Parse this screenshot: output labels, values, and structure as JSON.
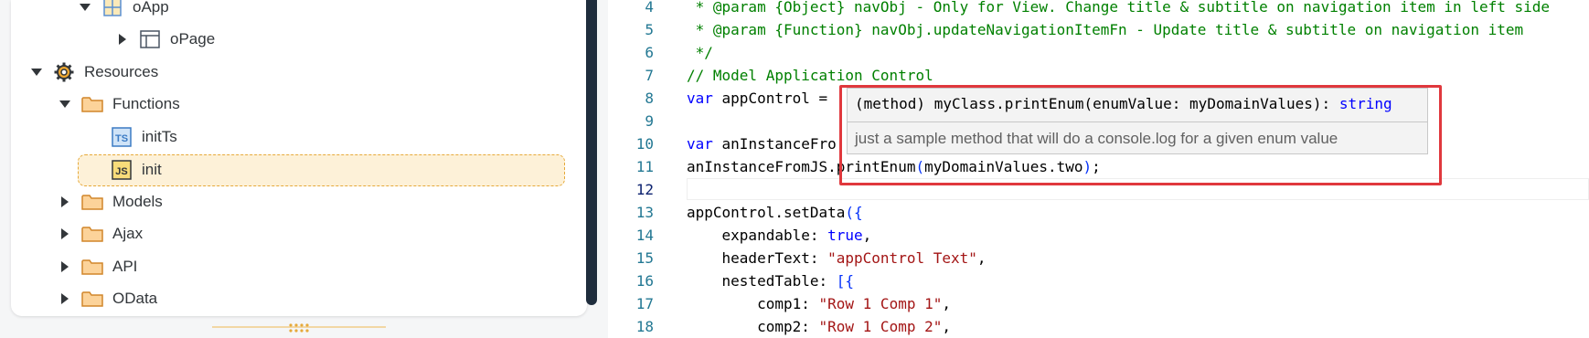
{
  "tree": {
    "items": [
      {
        "label": "oApp",
        "icon": "app-grid-icon",
        "state": "expanded"
      },
      {
        "label": "oPage",
        "icon": "page-layout-icon",
        "state": "collapsed"
      },
      {
        "label": "Resources",
        "icon": "gear-icon",
        "state": "expanded"
      },
      {
        "label": "Functions",
        "icon": "folder-icon",
        "state": "expanded"
      },
      {
        "label": "initTs",
        "icon": "typescript-file-icon",
        "badge": "TS",
        "state": "leaf"
      },
      {
        "label": "init",
        "icon": "javascript-file-icon",
        "badge": "JS",
        "state": "leaf",
        "selected": true
      },
      {
        "label": "Models",
        "icon": "folder-icon",
        "state": "collapsed"
      },
      {
        "label": "Ajax",
        "icon": "folder-icon",
        "state": "collapsed"
      },
      {
        "label": "API",
        "icon": "folder-icon",
        "state": "collapsed"
      },
      {
        "label": "OData",
        "icon": "folder-icon",
        "state": "collapsed"
      }
    ]
  },
  "editor": {
    "line_numbers": [
      "4",
      "5",
      "6",
      "7",
      "8",
      "9",
      "10",
      "11",
      "12",
      "13",
      "14",
      "15",
      "16",
      "17",
      "18"
    ],
    "code": {
      "l4": " * @param {Object} navObj - Only for View. Change title & subtitle on navigation item in left side",
      "l5": " * @param {Function} navObj.updateNavigationItemFn - Update title & subtitle on navigation item",
      "l6": " */",
      "l7": "// Model Application Control",
      "l8_kw": "var",
      "l8_rest": " appControl = ",
      "l10_kw": "var",
      "l10_rest": " anInstanceFro",
      "l11_a": "anInstanceFromJS.printEnum",
      "l11_b": "(",
      "l11_c": "myDomainValues.two",
      "l11_d": ")",
      "l11_e": ";",
      "l13_a": "appControl.setData",
      "l13_b": "({",
      "l14_a": "    expandable: ",
      "l14_b": "true",
      "l14_c": ",",
      "l15_a": "    headerText: ",
      "l15_b": "\"appControl Text\"",
      "l15_c": ",",
      "l16_a": "    nestedTable: ",
      "l16_b": "[{",
      "l17_a": "        comp1: ",
      "l17_b": "\"Row 1 Comp 1\"",
      "l17_c": ",",
      "l18_a": "        comp2: ",
      "l18_b": "\"Row 1 Comp 2\"",
      "l18_c": ","
    }
  },
  "hover": {
    "signature": "(method) myClass.printEnum(enumValue: myDomainValues): ",
    "return_type": "string",
    "doc": "just a sample method that will do a console.log for a given enum value"
  },
  "colors": {
    "comment": "#008000",
    "keyword": "#0000ff",
    "string": "#a31515",
    "line_number": "#237893",
    "highlight_box": "#e0383d",
    "selection_bg": "#fdf1d8"
  }
}
